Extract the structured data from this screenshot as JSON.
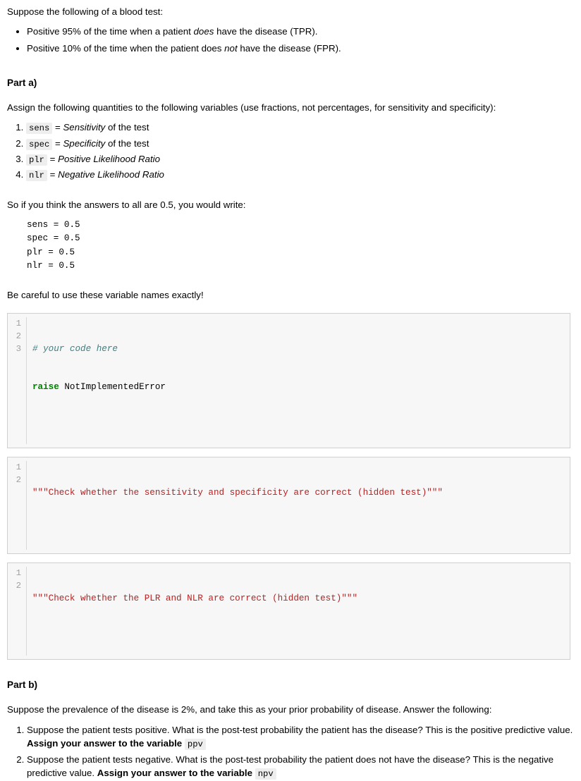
{
  "intro": {
    "lead": "Suppose the following of a blood test:",
    "bullets": [
      {
        "pre": "Positive 95% of the time when a patient ",
        "em": "does",
        "post": " have the disease (TPR)."
      },
      {
        "pre": "Positive 10% of the time when the patient does ",
        "em": "not",
        "post": " have the disease (FPR)."
      }
    ]
  },
  "part_a": {
    "heading": "Part a)",
    "instruction": "Assign the following quantities to the following variables (use fractions, not percentages, for sensitivity and specificity):",
    "variables": [
      {
        "code": "sens",
        "eq": "=",
        "em": "Sensitivity",
        "post": " of the test"
      },
      {
        "code": "spec",
        "eq": "=",
        "em": "Specificity",
        "post": " of the test"
      },
      {
        "code": "plr",
        "eq": "=",
        "em": "Positive Likelihood Ratio",
        "post": ""
      },
      {
        "code": "nlr",
        "eq": "=",
        "em": "Negative Likelihood Ratio",
        "post": ""
      }
    ],
    "example_lead": "So if you think the answers to all are 0.5, you would write:",
    "example_code": "sens = 0.5\nspec = 0.5\nplr = 0.5\nnlr = 0.5",
    "warning": "Be careful to use these variable names exactly!"
  },
  "cells": [
    {
      "line_numbers": [
        "1",
        "2",
        "3"
      ],
      "lines": [
        [
          {
            "t": "# your code here",
            "c": "comment"
          }
        ],
        [
          {
            "t": "raise",
            "c": "keyword"
          },
          {
            "t": " NotImplementedError",
            "c": "plain"
          }
        ],
        [
          {
            "t": "",
            "c": "plain"
          }
        ]
      ]
    },
    {
      "line_numbers": [
        "1",
        "2"
      ],
      "lines": [
        [
          {
            "t": "\"\"\"Check whether the sensitivity and specificity are correct (hidden test)\"\"\"",
            "c": "string"
          }
        ],
        [
          {
            "t": "",
            "c": "plain"
          }
        ]
      ]
    },
    {
      "line_numbers": [
        "1",
        "2"
      ],
      "lines": [
        [
          {
            "t": "\"\"\"Check whether the PLR and NLR are correct (hidden test)\"\"\"",
            "c": "string"
          }
        ],
        [
          {
            "t": "",
            "c": "plain"
          }
        ]
      ]
    }
  ],
  "part_b": {
    "heading": "Part b)",
    "instruction": "Suppose the prevalence of the disease is 2%, and take this as your prior probability of disease. Answer the following:",
    "questions": [
      {
        "text": "Suppose the patient tests positive. What is the post-test probability the patient has the disease? This is the positive predictive value. ",
        "bold": "Assign your answer to the variable",
        "code": "ppv"
      },
      {
        "text": "Suppose the patient tests negative. What is the post-test probability the patient does not have the disease? This is the negative predictive value. ",
        "bold": "Assign your answer to the variable",
        "code": "npv"
      }
    ]
  },
  "colors": {
    "comment": "#408080",
    "keyword": "#008000",
    "string": "#ba2121",
    "cell_background": "#f7f7f7",
    "cell_border": "#cfcfcf",
    "inline_code_background": "#eeeeee"
  }
}
